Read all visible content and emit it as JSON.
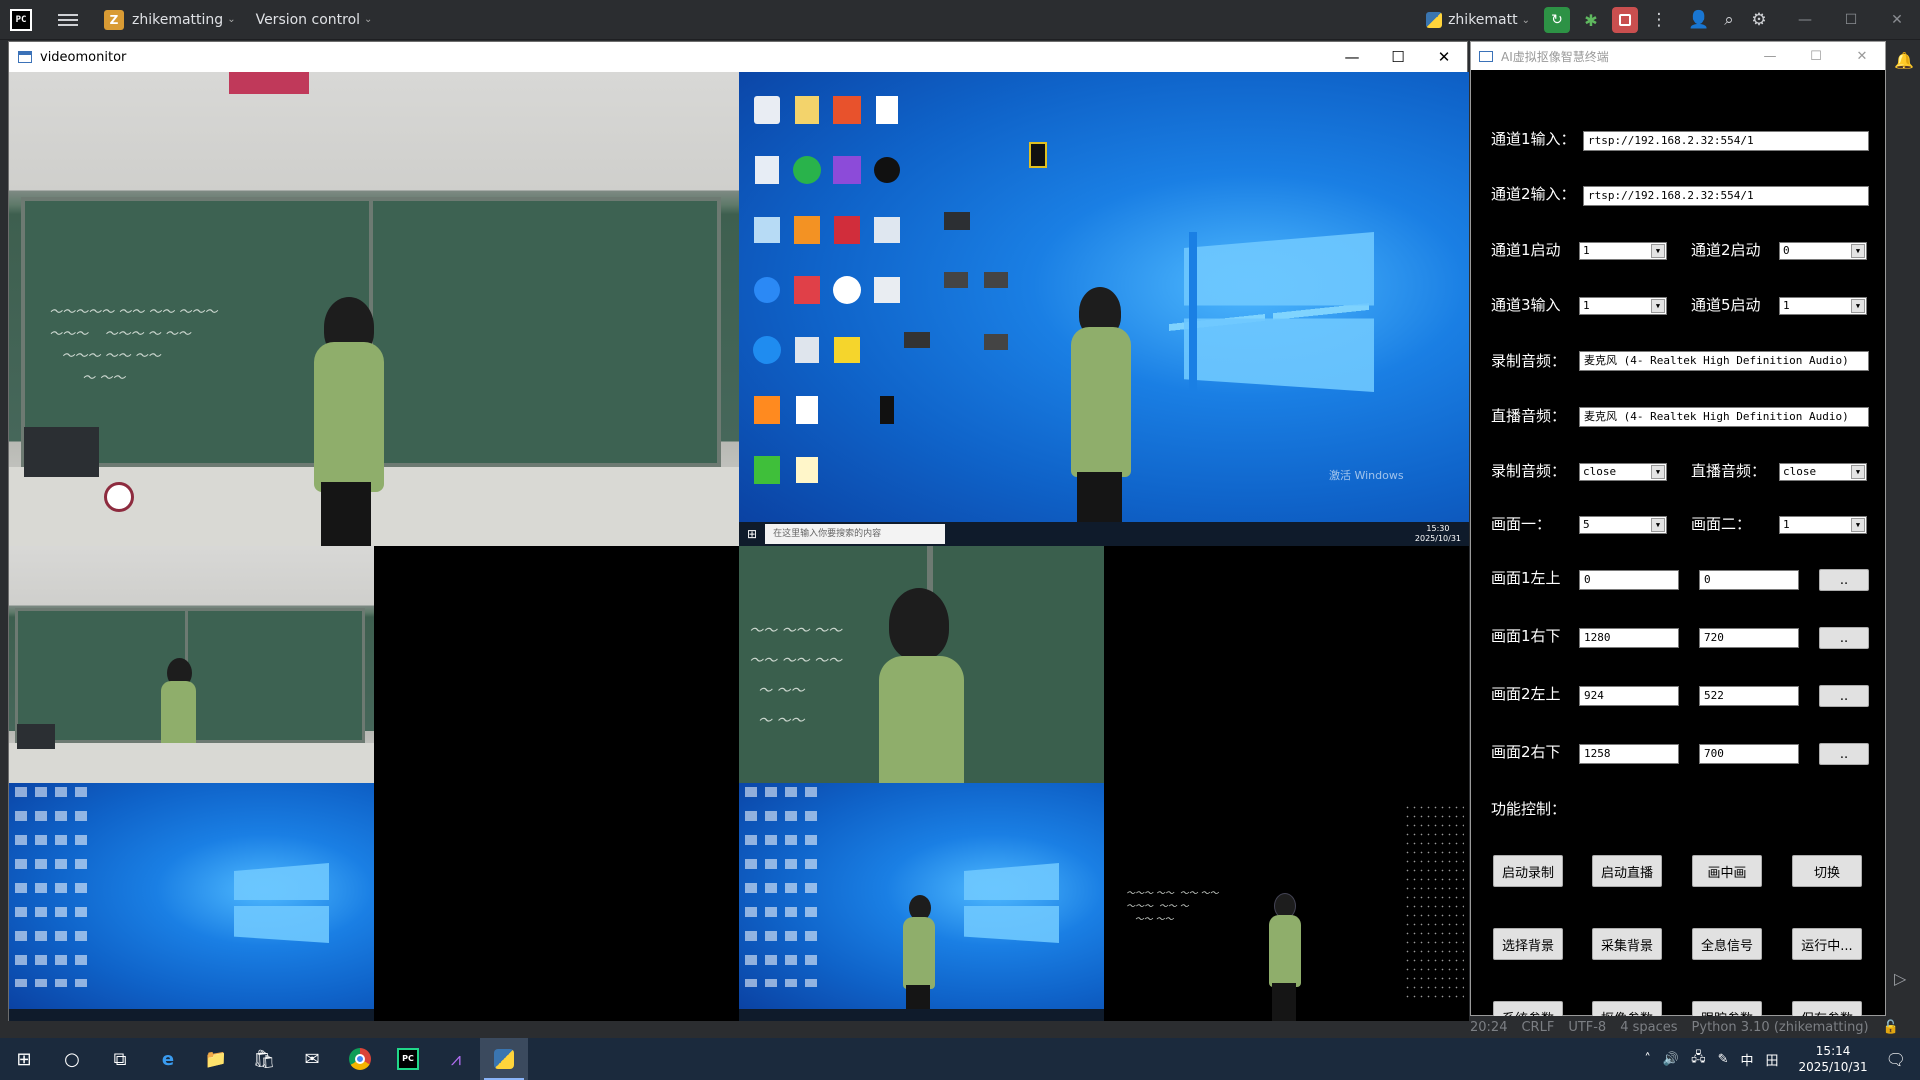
{
  "ide": {
    "project_badge": "Z",
    "project_name": "zhikematting",
    "vcs": "Version control",
    "run_config": "zhikematt"
  },
  "video_window": {
    "title": "videomonitor",
    "desktop_watermark_title": "激活 Windows",
    "search_placeholder": "在这里输入你要搜索的内容",
    "sys_time": "15:30",
    "sys_date": "2025/10/31"
  },
  "ai_panel": {
    "title": "AI虚拟抠像智慧终端",
    "ch1_input_label": "通道1输入：",
    "ch1_input_value": "rtsp://192.168.2.32:554/1",
    "ch2_input_label": "通道2输入：",
    "ch2_input_value": "rtsp://192.168.2.32:554/1",
    "ch1_start_label": "通道1启动",
    "ch1_start_value": "1",
    "ch2_start_label": "通道2启动",
    "ch2_start_value": "0",
    "ch3_input_label": "通道3输入",
    "ch3_input_value": "1",
    "ch5_input_label": "通道5启动",
    "ch5_input_value": "1",
    "rec_audio_label": "录制音频：",
    "rec_audio_value": "麦克风 (4- Realtek High Definition Audio)",
    "live_audio_label": "直播音频：",
    "live_audio_value": "麦克风 (4- Realtek High Definition Audio)",
    "rec_audio2_label": "录制音频：",
    "rec_audio2_value": "close",
    "live_audio2_label": "直播音频：",
    "live_audio2_value": "close",
    "screen1_label": "画面一：",
    "screen1_value": "5",
    "screen2_label": "画面二：",
    "screen2_value": "1",
    "s1_tl_label": "画面1左上",
    "s1_tl_x": "0",
    "s1_tl_y": "0",
    "s1_br_label": "画面1右下",
    "s1_br_x": "1280",
    "s1_br_y": "720",
    "s2_tl_label": "画面2左上",
    "s2_tl_x": "924",
    "s2_tl_y": "522",
    "s2_br_label": "画面2右下",
    "s2_br_x": "1258",
    "s2_br_y": "700",
    "dots": "..",
    "func_label": "功能控制：",
    "buttons": [
      "启动录制",
      "启动直播",
      "画中画",
      "切换",
      "选择背景",
      "采集背景",
      "全息信号",
      "运行中...",
      "系统参数",
      "抠像参数",
      "跟踪参数",
      "保存参数"
    ]
  },
  "status_bar": {
    "pos": "20:24",
    "eol": "CRLF",
    "enc": "UTF-8",
    "indent": "4 spaces",
    "interp": "Python 3.10 (zhikematting)"
  },
  "taskbar": {
    "time": "15:14",
    "date": "2025/10/31",
    "ime_cn": "中",
    "ime_grid": "田"
  }
}
